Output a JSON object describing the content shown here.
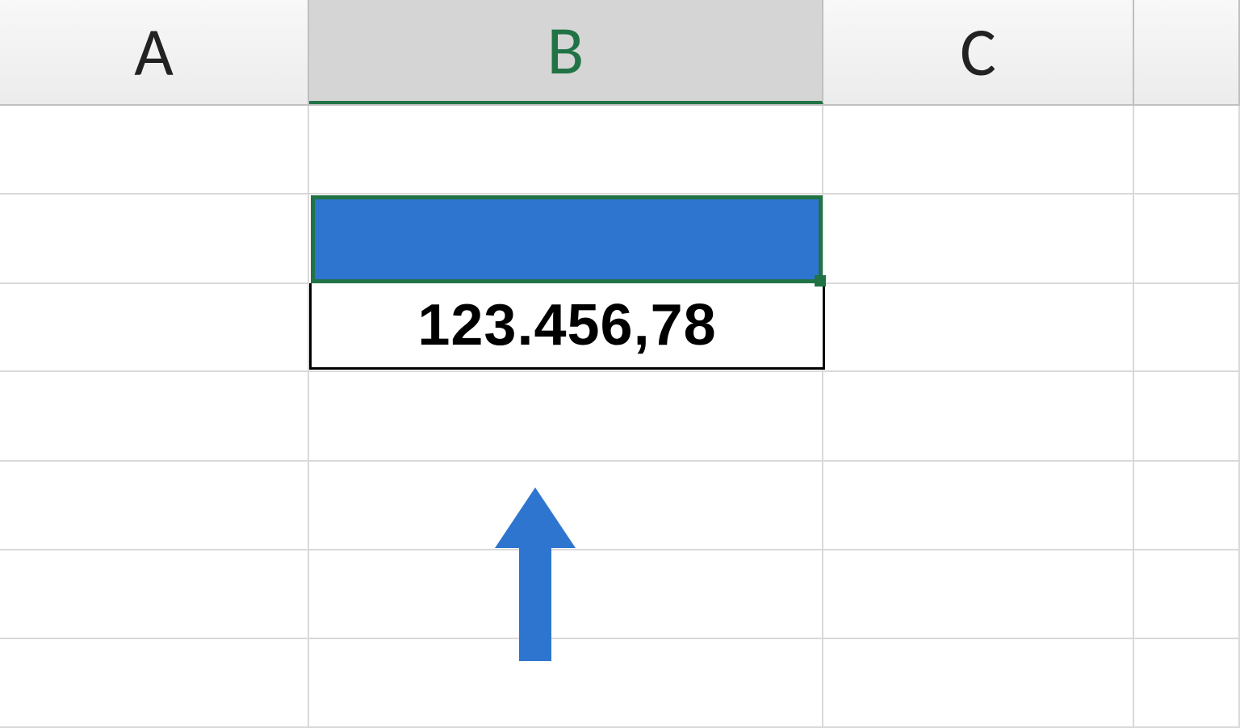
{
  "columns": {
    "a": "A",
    "b": "B",
    "c": "C"
  },
  "cells": {
    "b3_value": "123.456,78"
  },
  "colors": {
    "selection_border": "#217346",
    "selection_fill": "#2e75cf",
    "arrow": "#2e75cf"
  }
}
